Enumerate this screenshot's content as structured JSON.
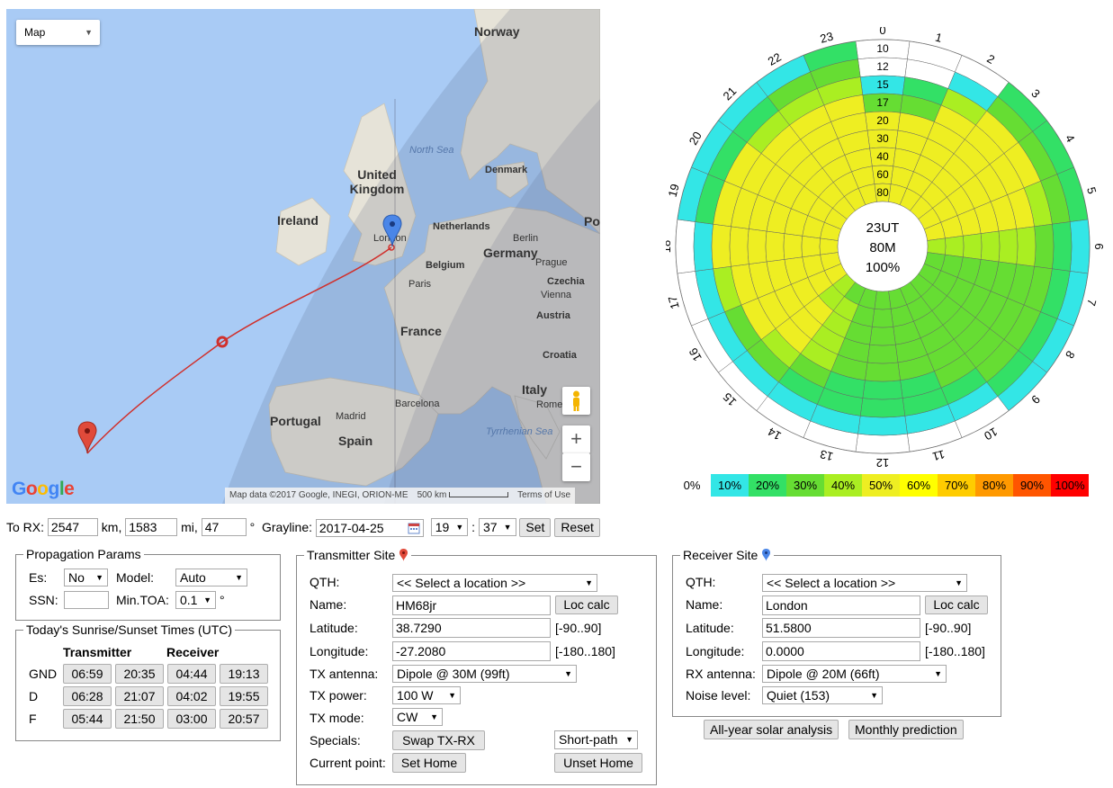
{
  "map": {
    "type_label": "Map",
    "labels": {
      "norway": "Norway",
      "north_sea": "North Sea",
      "denmark": "Denmark",
      "united_kingdom": "United Kingdom",
      "ireland": "Ireland",
      "netherlands": "Netherlands",
      "berlin": "Berlin",
      "germany": "Germany",
      "london": "London",
      "belgium": "Belgium",
      "prague": "Prague",
      "czechia": "Czechia",
      "paris": "Paris",
      "vienna": "Vienna",
      "austria": "Austria",
      "france": "France",
      "croatia": "Croatia",
      "italy": "Italy",
      "rome": "Rome",
      "tyrrhenian_sea": "Tyrrhenian Sea",
      "portugal": "Portugal",
      "madrid": "Madrid",
      "barcelona": "Barcelona",
      "spain": "Spain",
      "po": "Po"
    },
    "logo": "Google",
    "attribution": "Map data ©2017 Google, INEGI, ORION-ME",
    "scale": "500 km",
    "terms": "Terms of Use",
    "zoom_in": "+",
    "zoom_out": "−"
  },
  "polar": {
    "center_lines": [
      "23UT",
      "80M",
      "100%"
    ],
    "ring_labels": [
      "10",
      "12",
      "15",
      "17",
      "20",
      "30",
      "40",
      "60",
      "80"
    ],
    "hours": [
      "0",
      "1",
      "2",
      "3",
      "4",
      "5",
      "6",
      "7",
      "8",
      "9",
      "10",
      "11",
      "12",
      "13",
      "14",
      "15",
      "16",
      "17",
      "18",
      "19",
      "20",
      "21",
      "22",
      "23"
    ],
    "grid": [
      [
        0,
        0,
        0,
        2,
        2,
        2,
        1,
        1,
        1,
        1,
        0,
        0,
        0,
        0,
        0,
        0,
        0,
        0,
        0,
        1,
        1,
        1,
        1,
        2
      ],
      [
        0,
        0,
        1,
        3,
        3,
        3,
        2,
        2,
        2,
        2,
        1,
        1,
        1,
        1,
        1,
        1,
        1,
        1,
        1,
        2,
        2,
        2,
        3,
        3
      ],
      [
        1,
        2,
        4,
        5,
        5,
        4,
        3,
        3,
        3,
        3,
        2,
        2,
        2,
        2,
        2,
        3,
        3,
        4,
        5,
        5,
        5,
        4,
        4,
        4
      ],
      [
        3,
        3,
        5,
        5,
        5,
        5,
        4,
        3,
        3,
        3,
        3,
        2,
        2,
        2,
        3,
        4,
        5,
        5,
        5,
        5,
        5,
        5,
        5,
        5
      ],
      [
        5,
        5,
        5,
        5,
        5,
        5,
        4,
        3,
        3,
        3,
        3,
        3,
        3,
        3,
        4,
        5,
        5,
        5,
        5,
        5,
        5,
        5,
        5,
        5
      ],
      [
        5,
        5,
        5,
        5,
        5,
        5,
        4,
        3,
        3,
        3,
        3,
        3,
        3,
        3,
        4,
        5,
        5,
        5,
        5,
        5,
        5,
        5,
        5,
        5
      ],
      [
        5,
        5,
        5,
        5,
        5,
        5,
        4,
        3,
        3,
        3,
        3,
        3,
        3,
        3,
        4,
        5,
        5,
        5,
        5,
        5,
        5,
        5,
        5,
        5
      ],
      [
        5,
        5,
        5,
        5,
        5,
        5,
        4,
        3,
        3,
        3,
        3,
        3,
        3,
        3,
        4,
        4,
        5,
        5,
        5,
        5,
        5,
        5,
        5,
        5
      ],
      [
        5,
        5,
        5,
        5,
        5,
        5,
        4,
        3,
        3,
        3,
        3,
        3,
        3,
        3,
        3,
        4,
        5,
        5,
        5,
        5,
        5,
        5,
        5,
        5
      ]
    ],
    "legend": [
      "0%",
      "10%",
      "20%",
      "30%",
      "40%",
      "50%",
      "60%",
      "70%",
      "80%",
      "90%",
      "100%"
    ],
    "legend_colors": [
      "#ffffff",
      "#33e6e6",
      "#33e066",
      "#66dd33",
      "#aaee22",
      "#eeee22",
      "#ffff00",
      "#ffcc00",
      "#ff9900",
      "#ff5500",
      "#ff0000"
    ]
  },
  "path": {
    "to_rx_label": "To RX:",
    "km_value": "2547",
    "km_label": "km,",
    "mi_value": "1583",
    "mi_label": "mi,",
    "deg_value": "47",
    "deg_label": "°",
    "grayline_label": "Grayline:",
    "date": "2017-04-25",
    "hour": "19",
    "colon": ":",
    "minute": "37",
    "set_label": "Set",
    "reset_label": "Reset"
  },
  "prop": {
    "title": "Propagation Params",
    "es_label": "Es:",
    "es_value": "No",
    "model_label": "Model:",
    "model_value": "Auto",
    "ssn_label": "SSN:",
    "ssn_value": "",
    "toa_label": "Min.TOA:",
    "toa_value": "0.1",
    "toa_unit": "°"
  },
  "sun": {
    "title": "Today's Sunrise/Sunset Times (UTC)",
    "tx_header": "Transmitter",
    "rx_header": "Receiver",
    "rows": [
      {
        "label": "GND",
        "times": [
          "06:59",
          "20:35",
          "04:44",
          "19:13"
        ]
      },
      {
        "label": "D",
        "times": [
          "06:28",
          "21:07",
          "04:02",
          "19:55"
        ]
      },
      {
        "label": "F",
        "times": [
          "05:44",
          "21:50",
          "03:00",
          "20:57"
        ]
      }
    ]
  },
  "tx": {
    "title": "Transmitter Site",
    "qth_label": "QTH:",
    "qth_value": "<< Select a location >>",
    "name_label": "Name:",
    "name_value": "HM68jr",
    "loc_calc": "Loc calc",
    "lat_label": "Latitude:",
    "lat_value": "38.7290",
    "lat_range": "[-90..90]",
    "lon_label": "Longitude:",
    "lon_value": "-27.2080",
    "lon_range": "[-180..180]",
    "antenna_label": "TX antenna:",
    "antenna_value": "Dipole @ 30M (99ft)",
    "power_label": "TX power:",
    "power_value": "100 W",
    "mode_label": "TX mode:",
    "mode_value": "CW",
    "specials_label": "Specials:",
    "swap_label": "Swap TX-RX",
    "path_value": "Short-path",
    "current_label": "Current point:",
    "set_home": "Set Home",
    "unset_home": "Unset Home"
  },
  "rx": {
    "title": "Receiver Site",
    "qth_label": "QTH:",
    "qth_value": "<< Select a location >>",
    "name_label": "Name:",
    "name_value": "London",
    "loc_calc": "Loc calc",
    "lat_label": "Latitude:",
    "lat_value": "51.5800",
    "lat_range": "[-90..90]",
    "lon_label": "Longitude:",
    "lon_value": "0.0000",
    "lon_range": "[-180..180]",
    "antenna_label": "RX antenna:",
    "antenna_value": "Dipole @ 20M (66ft)",
    "noise_label": "Noise level:",
    "noise_value": "Quiet (153)"
  },
  "actions": {
    "solar_label": "All-year solar analysis",
    "monthly_label": "Monthly prediction"
  }
}
